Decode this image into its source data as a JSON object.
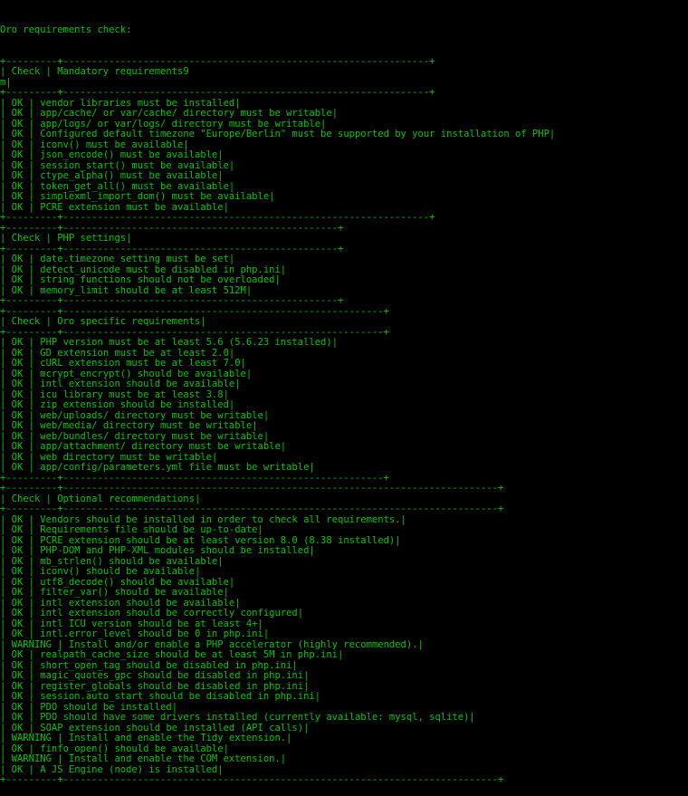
{
  "title": "Oro requirements check:",
  "colors": {
    "border": "#00c800",
    "text": "#c0c0c0",
    "background": "#000000"
  },
  "tables": [
    {
      "name": "mandatory",
      "inner_width": 64,
      "first_col_header": "Check",
      "header": "Mandatory requirements",
      "header_suffix": "9",
      "wrap_fragment": "m|",
      "rows": [
        {
          "check": "OK",
          "text": "vendor libraries must be installed"
        },
        {
          "check": "OK",
          "text": "app/cache/ or var/cache/ directory must be writable"
        },
        {
          "check": "OK",
          "text": "app/logs/ or var/logs/ directory must be writable"
        },
        {
          "check": "OK",
          "text": "Configured default timezone \"Europe/Berlin\" must be supported by your installation of PHP"
        },
        {
          "check": "OK",
          "text": "iconv() must be available"
        },
        {
          "check": "OK",
          "text": "json_encode() must be available"
        },
        {
          "check": "OK",
          "text": "session_start() must be available"
        },
        {
          "check": "OK",
          "text": "ctype_alpha() must be available"
        },
        {
          "check": "OK",
          "text": "token_get_all() must be available"
        },
        {
          "check": "OK",
          "text": "simplexml_import_dom() must be available"
        },
        {
          "check": "OK",
          "text": "PCRE extension must be available"
        }
      ]
    },
    {
      "name": "php-settings",
      "inner_width": 48,
      "first_col_header": "Check",
      "header": "PHP settings",
      "rows": [
        {
          "check": "OK",
          "text": "date.timezone setting must be set"
        },
        {
          "check": "OK",
          "text": "detect_unicode must be disabled in php.ini"
        },
        {
          "check": "OK",
          "text": "string functions should not be overloaded"
        },
        {
          "check": "OK",
          "text": "memory_limit should be at least 512M"
        }
      ]
    },
    {
      "name": "oro-specific",
      "inner_width": 56,
      "first_col_header": "Check",
      "header": "Oro specific requirements",
      "rows": [
        {
          "check": "OK",
          "text": "PHP version must be at least 5.6 (5.6.23 installed)"
        },
        {
          "check": "OK",
          "text": "GD extension must be at least 2.0"
        },
        {
          "check": "OK",
          "text": "cURL extension must be at least 7.0"
        },
        {
          "check": "OK",
          "text": "mcrypt_encrypt() should be available"
        },
        {
          "check": "OK",
          "text": "intl extension should be available"
        },
        {
          "check": "OK",
          "text": "icu library must be at least 3.8"
        },
        {
          "check": "OK",
          "text": "zip extension should be installed"
        },
        {
          "check": "OK",
          "text": "web/uploads/ directory must be writable"
        },
        {
          "check": "OK",
          "text": "web/media/ directory must be writable"
        },
        {
          "check": "OK",
          "text": "web/bundles/ directory must be writable"
        },
        {
          "check": "OK",
          "text": "app/attachment/ directory must be writable"
        },
        {
          "check": "OK",
          "text": "web directory must be writable"
        },
        {
          "check": "OK",
          "text": "app/config/parameters.yml file must be writable"
        }
      ]
    },
    {
      "name": "optional",
      "inner_width": 76,
      "first_col_header": "Check",
      "header": "Optional recommendations",
      "rows": [
        {
          "check": "OK",
          "text": "Vendors should be installed in order to check all requirements."
        },
        {
          "check": "OK",
          "text": "Requirements file should be up-to-date"
        },
        {
          "check": "OK",
          "text": "PCRE extension should be at least version 8.0 (8.38 installed)"
        },
        {
          "check": "OK",
          "text": "PHP-DOM and PHP-XML modules should be installed"
        },
        {
          "check": "OK",
          "text": "mb_strlen() should be available"
        },
        {
          "check": "OK",
          "text": "iconv() should be available"
        },
        {
          "check": "OK",
          "text": "utf8_decode() should be available"
        },
        {
          "check": "OK",
          "text": "filter_var() should be available"
        },
        {
          "check": "OK",
          "text": "intl extension should be available"
        },
        {
          "check": "OK",
          "text": "intl extension should be correctly configured"
        },
        {
          "check": "OK",
          "text": "intl ICU version should be at least 4+"
        },
        {
          "check": "OK",
          "text": "intl.error_level should be 0 in php.ini"
        },
        {
          "check": "WARNING",
          "text": "Install and/or enable a PHP accelerator (highly recommended)."
        },
        {
          "check": "OK",
          "text": "realpath_cache_size should be at least 5M in php.ini"
        },
        {
          "check": "OK",
          "text": "short_open_tag should be disabled in php.ini"
        },
        {
          "check": "OK",
          "text": "magic_quotes_gpc should be disabled in php.ini"
        },
        {
          "check": "OK",
          "text": "register_globals should be disabled in php.ini"
        },
        {
          "check": "OK",
          "text": "session.auto_start should be disabled in php.ini"
        },
        {
          "check": "OK",
          "text": "PDO should be installed"
        },
        {
          "check": "OK",
          "text": "PDO should have some drivers installed (currently available: mysql, sqlite)"
        },
        {
          "check": "OK",
          "text": "SOAP extension should be installed (API calls)"
        },
        {
          "check": "WARNING",
          "text": "Install and enable the Tidy extension."
        },
        {
          "check": "OK",
          "text": "finfo_open() should be available"
        },
        {
          "check": "WARNING",
          "text": "Install and enable the COM extension."
        },
        {
          "check": "OK",
          "text": "A JS Engine (node) is installed"
        }
      ]
    }
  ]
}
